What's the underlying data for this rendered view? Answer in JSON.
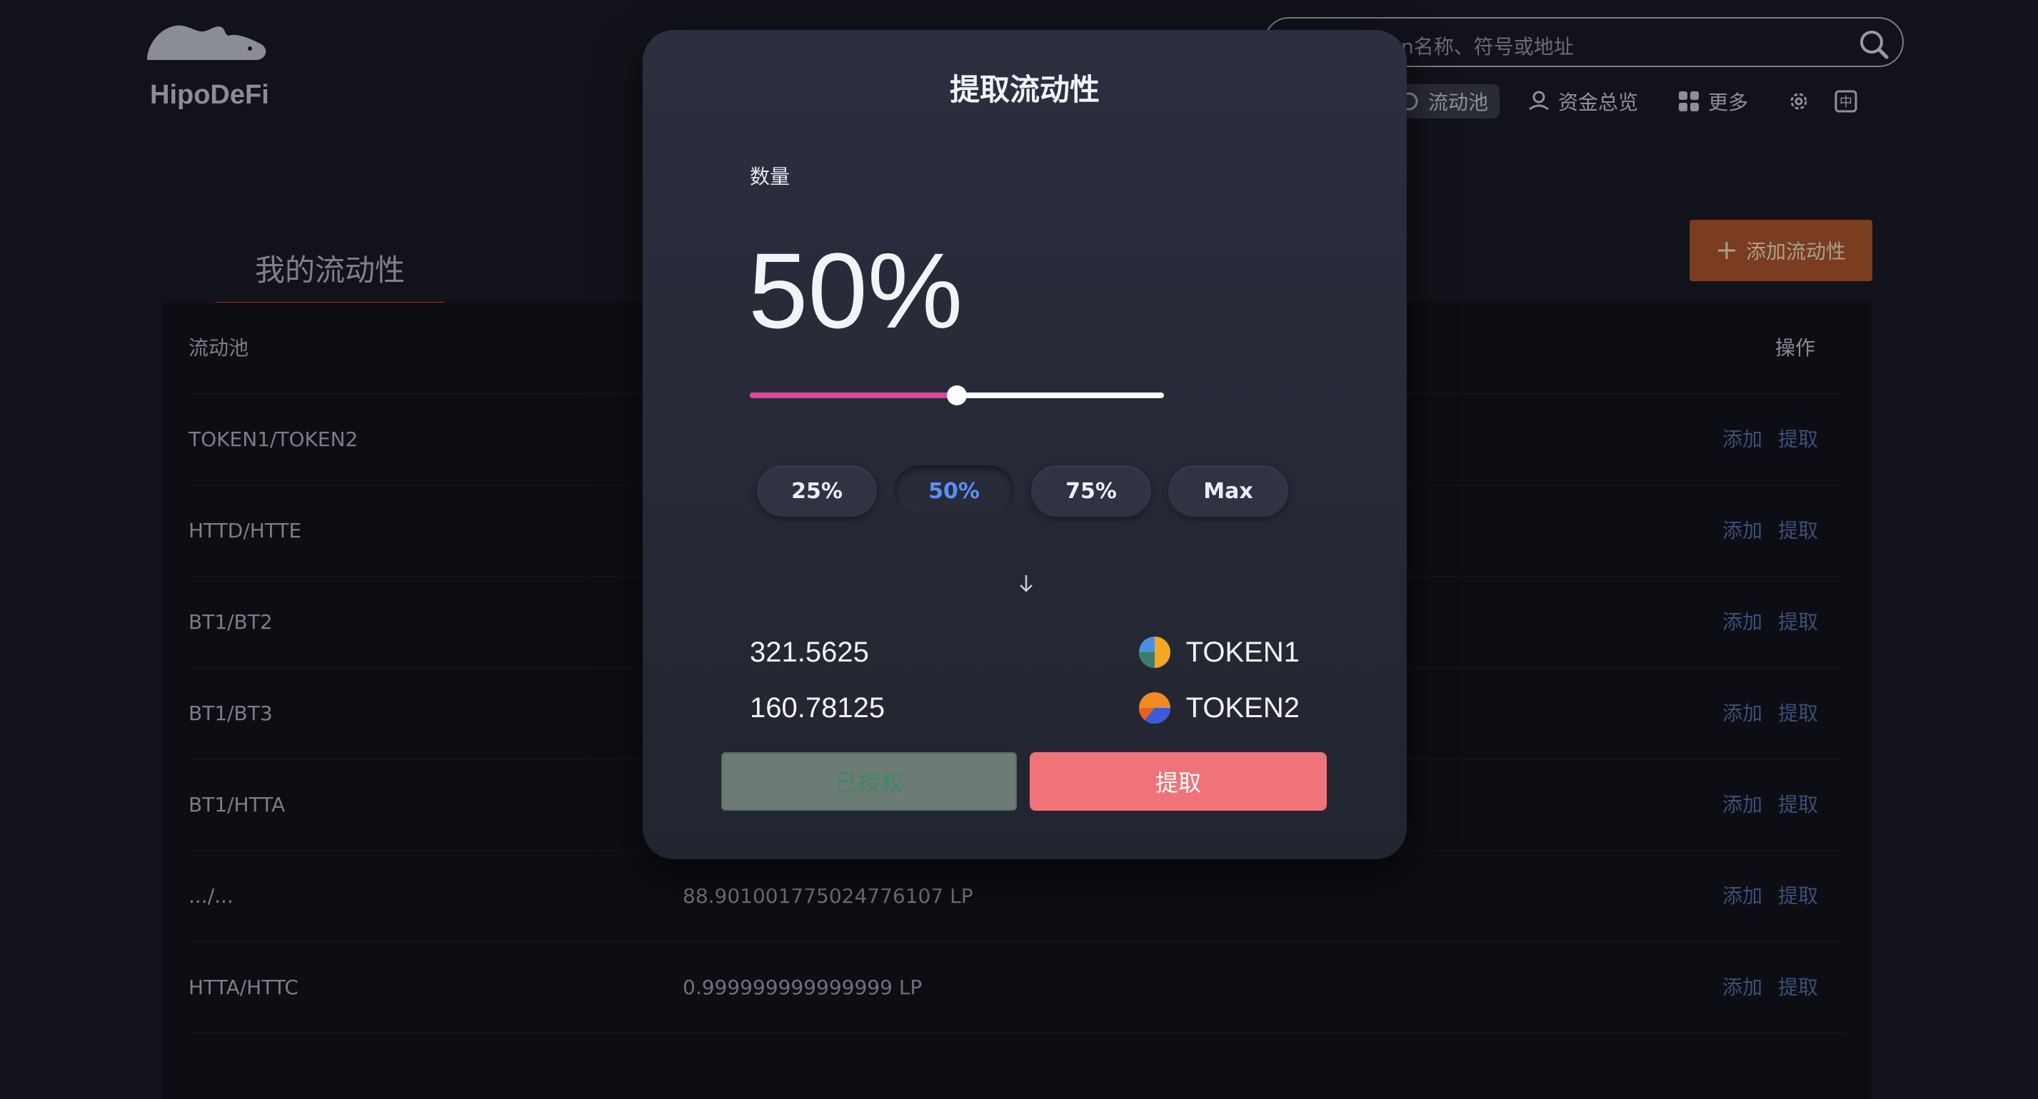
{
  "app": {
    "name": "HipoDeFi"
  },
  "search": {
    "placeholder_visible": "n名称、符号或地址"
  },
  "nav": {
    "items": [
      {
        "label": "流动池",
        "icon": "pool-icon"
      },
      {
        "label": "资金总览",
        "icon": "funds-icon"
      },
      {
        "label": "更多",
        "icon": "grid-icon"
      }
    ],
    "settings_icon": "gear-icon",
    "language_icon": "language-icon",
    "language_glyph": "中"
  },
  "tab": {
    "title": "我的流动性"
  },
  "add_liquidity": {
    "label": "添加流动性"
  },
  "table": {
    "header": {
      "pool": "流动池",
      "action": "操作"
    },
    "rows": [
      {
        "pool": "TOKEN1/TOKEN2",
        "amount": "",
        "add": "添加",
        "remove": "提取"
      },
      {
        "pool": "HTTD/HTTE",
        "amount": "",
        "add": "添加",
        "remove": "提取"
      },
      {
        "pool": "BT1/BT2",
        "amount": "",
        "add": "添加",
        "remove": "提取"
      },
      {
        "pool": "BT1/BT3",
        "amount": "",
        "add": "添加",
        "remove": "提取"
      },
      {
        "pool": "BT1/HTTA",
        "amount": "",
        "add": "添加",
        "remove": "提取"
      },
      {
        "pool": ".../...",
        "amount": "88.901001775024776107 LP",
        "add": "添加",
        "remove": "提取"
      },
      {
        "pool": "HTTA/HTTC",
        "amount": "0.999999999999999 LP",
        "add": "添加",
        "remove": "提取"
      }
    ]
  },
  "modal": {
    "title": "提取流动性",
    "amount_label": "数量",
    "percent_display": "50%",
    "slider_value": 0.5,
    "pills": [
      "25%",
      "50%",
      "75%",
      "Max"
    ],
    "selected_pill": "50%",
    "outputs": [
      {
        "value": "321.5625",
        "token": "TOKEN1"
      },
      {
        "value": "160.78125",
        "token": "TOKEN2"
      }
    ],
    "approved_label": "已授权",
    "withdraw_label": "提取"
  },
  "colors": {
    "accent_pink": "#e0449e",
    "selected_blue": "#5b8ff9",
    "withdraw_red": "#f0737a",
    "add_brown": "#7a3d1f",
    "link_blue": "#3a4f7a"
  }
}
